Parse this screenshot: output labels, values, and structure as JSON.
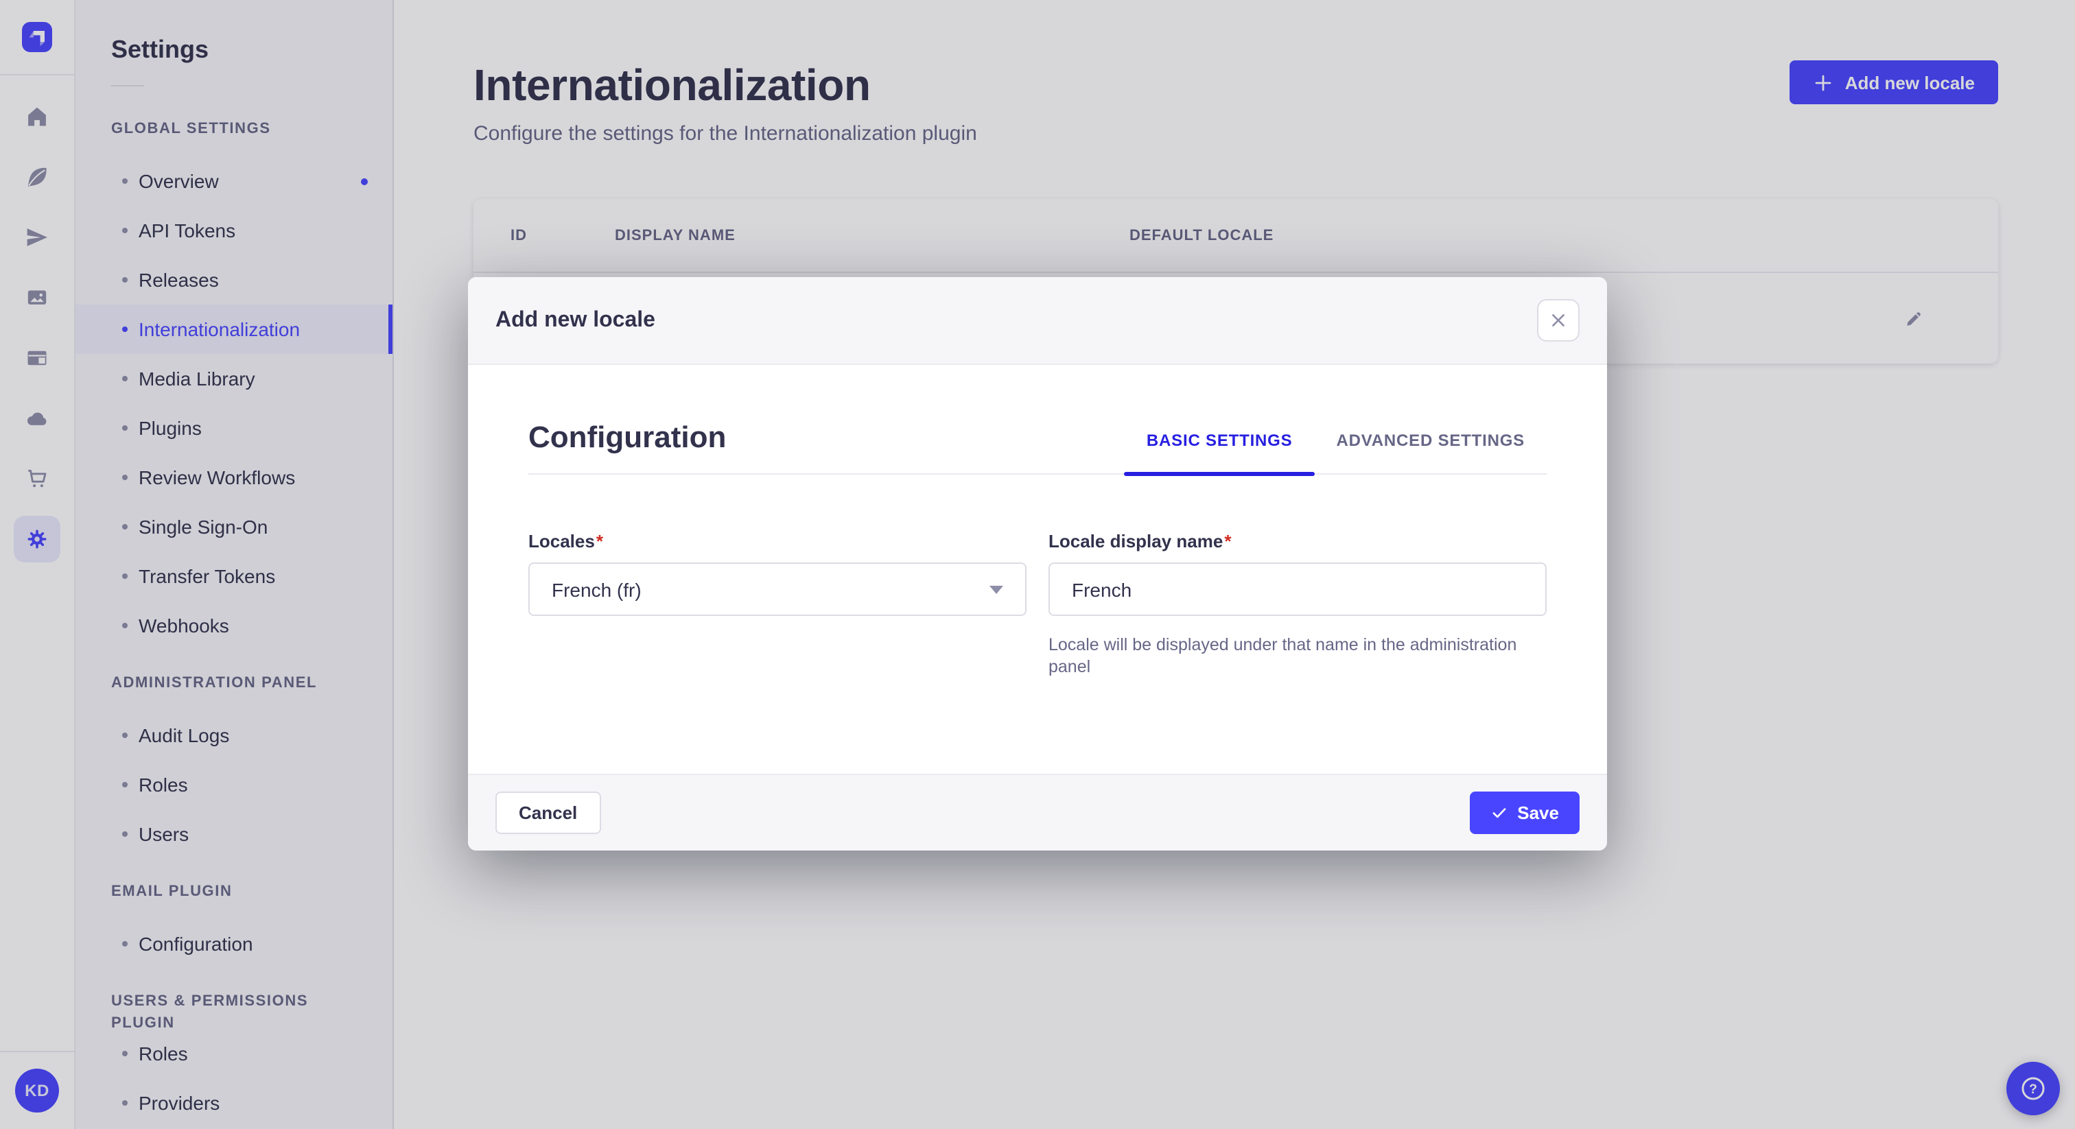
{
  "iconbar": {
    "logo_icon": "strapi-logo",
    "icons": [
      "home-icon",
      "feather-icon",
      "send-icon",
      "media-library-icon",
      "layout-icon",
      "cloud-icon",
      "cart-icon",
      "settings-gear-icon"
    ],
    "avatar_initials": "KD"
  },
  "subnav": {
    "title": "Settings",
    "sections": [
      {
        "label": "GLOBAL SETTINGS",
        "items": [
          {
            "label": "Overview",
            "has_notification_dot": true
          },
          {
            "label": "API Tokens"
          },
          {
            "label": "Releases"
          },
          {
            "label": "Internationalization",
            "selected": true
          },
          {
            "label": "Media Library"
          },
          {
            "label": "Plugins"
          },
          {
            "label": "Review Workflows"
          },
          {
            "label": "Single Sign-On"
          },
          {
            "label": "Transfer Tokens"
          },
          {
            "label": "Webhooks"
          }
        ]
      },
      {
        "label": "ADMINISTRATION PANEL",
        "items": [
          {
            "label": "Audit Logs"
          },
          {
            "label": "Roles"
          },
          {
            "label": "Users"
          }
        ]
      },
      {
        "label": "EMAIL PLUGIN",
        "items": [
          {
            "label": "Configuration"
          }
        ]
      },
      {
        "label": "USERS & PERMISSIONS PLUGIN",
        "items": [
          {
            "label": "Roles"
          },
          {
            "label": "Providers"
          }
        ]
      }
    ]
  },
  "page": {
    "title": "Internationalization",
    "subtitle": "Configure the settings for the Internationalization plugin",
    "add_locale_button": "Add new locale"
  },
  "table": {
    "columns": [
      "ID",
      "DISPLAY NAME",
      "DEFAULT LOCALE"
    ],
    "row_action_icon": "pencil-icon"
  },
  "modal": {
    "title": "Add new locale",
    "close_icon": "close-icon",
    "section_title": "Configuration",
    "tabs": [
      {
        "label": "BASIC SETTINGS",
        "active": true
      },
      {
        "label": "ADVANCED SETTINGS",
        "active": false
      }
    ],
    "required_mark": "*",
    "locales_field": {
      "label": "Locales",
      "value": "French (fr)"
    },
    "display_name_field": {
      "label": "Locale display name",
      "value": "French",
      "helper": "Locale will be displayed under that name in the administration panel"
    },
    "cancel_button": "Cancel",
    "save_button": "Save"
  },
  "help": {
    "icon": "question-mark-icon"
  },
  "colors": {
    "primary": "#4945FF",
    "tab_active": "#271FE0",
    "danger": "#D02B20",
    "text": "#32324D",
    "text_muted": "#666687",
    "border": "#DCDCE4",
    "divider": "#EAEAEF",
    "surface_muted": "#F6F6F9"
  }
}
